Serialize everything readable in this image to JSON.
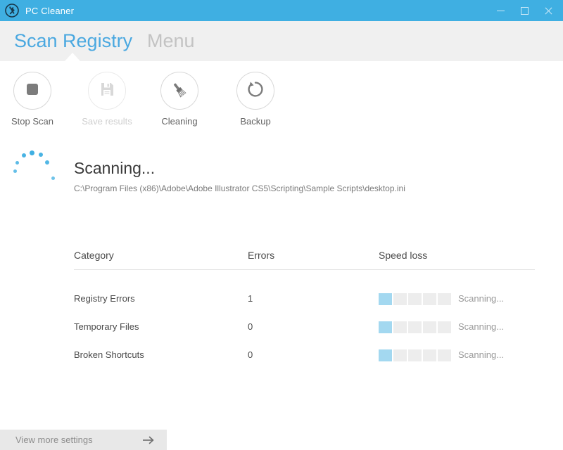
{
  "window": {
    "title": "PC Cleaner",
    "icon": "wrench-screwdriver-circle-icon",
    "accent_color": "#3fafe2",
    "controls": {
      "minimize": "minimize-icon",
      "maximize": "maximize-icon",
      "close": "close-icon"
    }
  },
  "tabs": [
    {
      "label": "Scan Registry",
      "active": true,
      "color": "#4aa8e0"
    },
    {
      "label": "Menu",
      "active": false,
      "color": "#c3c3c3"
    }
  ],
  "toolbar": {
    "buttons": [
      {
        "label": "Stop Scan",
        "icon": "stop-square-icon",
        "enabled": true
      },
      {
        "label": "Save results",
        "icon": "floppy-disk-icon",
        "enabled": false
      },
      {
        "label": "Cleaning",
        "icon": "brush-icon",
        "enabled": true
      },
      {
        "label": "Backup",
        "icon": "restore-arrow-icon",
        "enabled": true
      }
    ]
  },
  "scan": {
    "spinner_icon": "loading-dots-spinner",
    "spinner_color": "#3fafe2",
    "title": "Scanning...",
    "path": "C:\\Program Files (x86)\\Adobe\\Adobe Illustrator CS5\\Scripting\\Sample Scripts\\desktop.ini"
  },
  "table": {
    "headers": {
      "category": "Category",
      "errors": "Errors",
      "speed_loss": "Speed loss"
    },
    "meter_segments": 5,
    "meter_on_color": "#a3d8f0",
    "meter_off_color": "#ededed",
    "rows": [
      {
        "category": "Registry Errors",
        "errors": "1",
        "speed_loss_filled": 1,
        "status": "Scanning..."
      },
      {
        "category": "Temporary Files",
        "errors": "0",
        "speed_loss_filled": 1,
        "status": "Scanning..."
      },
      {
        "category": "Broken Shortcuts",
        "errors": "0",
        "speed_loss_filled": 1,
        "status": "Scanning..."
      }
    ]
  },
  "footer": {
    "label": "View more settings",
    "arrow_icon": "arrow-right-icon"
  }
}
